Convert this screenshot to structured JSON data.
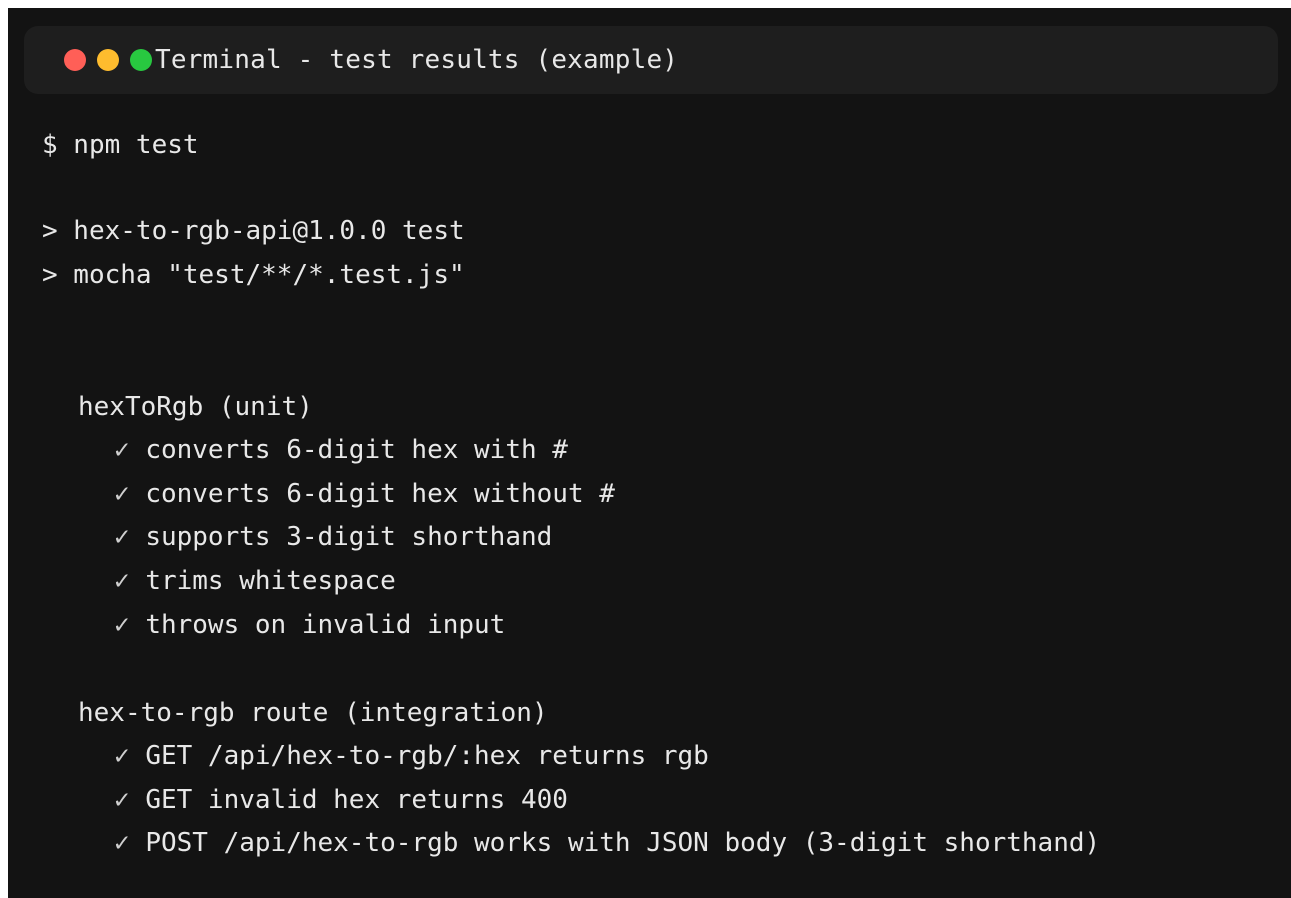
{
  "window": {
    "title": "Terminal - test results (example)",
    "controls": [
      "close",
      "minimize",
      "maximize"
    ]
  },
  "colors": {
    "background": "#131313",
    "titlebar": "#1e1e1e",
    "text": "#e8e8e8",
    "close": "#ff5f57",
    "minimize": "#febc2e",
    "maximize": "#28c840"
  },
  "output": {
    "command": "$ npm test",
    "script_lines": [
      "> hex-to-rgb-api@1.0.0 test",
      "> mocha \"test/**/*.test.js\""
    ],
    "suites": [
      {
        "name": "hexToRgb (unit)",
        "tests": [
          "converts 6-digit hex with #",
          "converts 6-digit hex without #",
          "supports 3-digit shorthand",
          "trims whitespace",
          "throws on invalid input"
        ]
      },
      {
        "name": "hex-to-rgb route (integration)",
        "tests": [
          "GET /api/hex-to-rgb/:hex returns rgb",
          "GET invalid hex returns 400",
          "POST /api/hex-to-rgb works with JSON body (3-digit shorthand)"
        ]
      }
    ],
    "pass_mark": "✓"
  }
}
